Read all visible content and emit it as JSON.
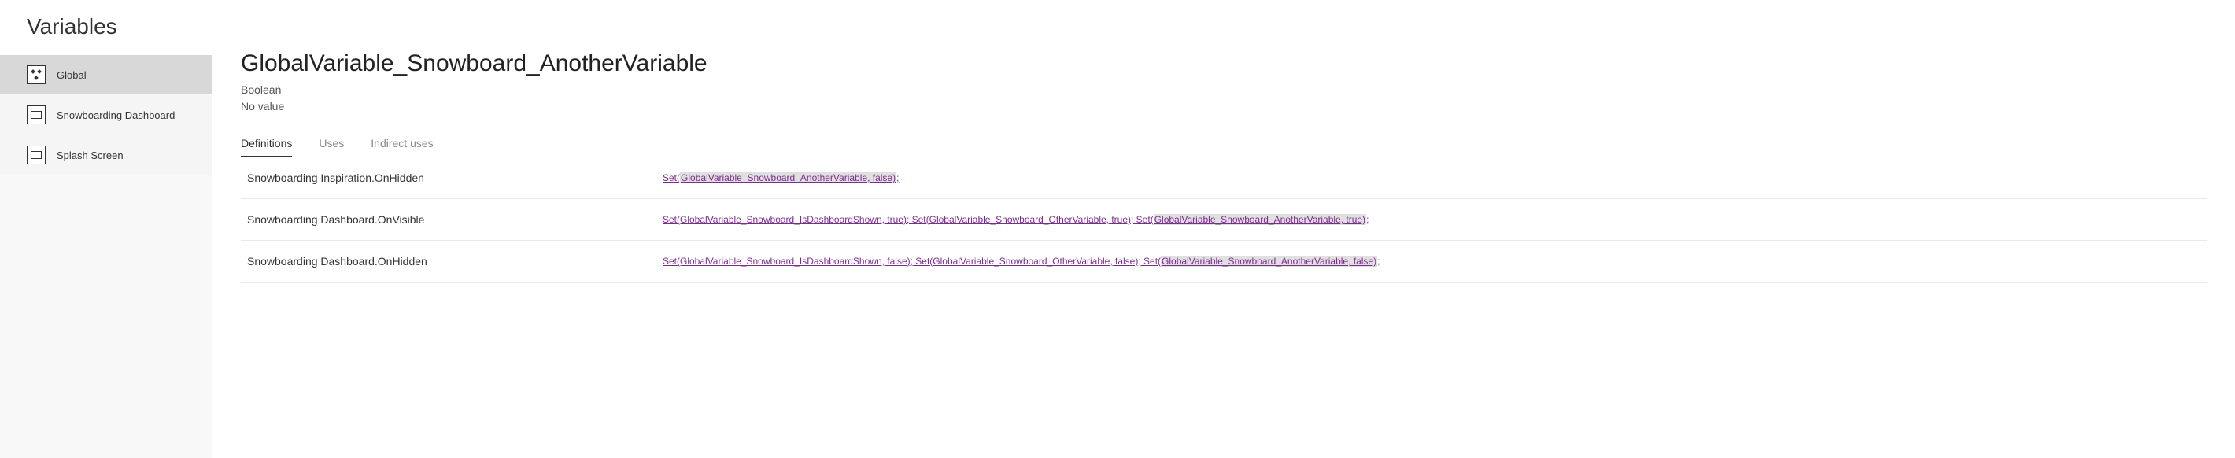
{
  "sidebar": {
    "title": "Variables",
    "items": [
      {
        "label": "Global"
      },
      {
        "label": "Snowboarding Dashboard"
      },
      {
        "label": "Splash Screen"
      }
    ]
  },
  "main": {
    "title": "GlobalVariable_Snowboard_AnotherVariable",
    "type": "Boolean",
    "value": "No value"
  },
  "tabs": [
    {
      "label": "Definitions"
    },
    {
      "label": "Uses"
    },
    {
      "label": "Indirect uses"
    }
  ],
  "defs": [
    {
      "source": "Snowboarding Inspiration.OnHidden",
      "pre": "Set(",
      "hl": "GlobalVariable_Snowboard_AnotherVariable, false)",
      "post": ";"
    },
    {
      "source": "Snowboarding Dashboard.OnVisible",
      "pre": "Set(GlobalVariable_Snowboard_IsDashboardShown, true);  Set(GlobalVariable_Snowboard_OtherVariable, true);  Set(",
      "hl": "GlobalVariable_Snowboard_AnotherVariable, true)",
      "post": ";"
    },
    {
      "source": "Snowboarding Dashboard.OnHidden",
      "pre": "Set(GlobalVariable_Snowboard_IsDashboardShown, false);  Set(GlobalVariable_Snowboard_OtherVariable, false);  Set(",
      "hl": "GlobalVariable_Snowboard_AnotherVariable, false)",
      "post": ";"
    }
  ]
}
